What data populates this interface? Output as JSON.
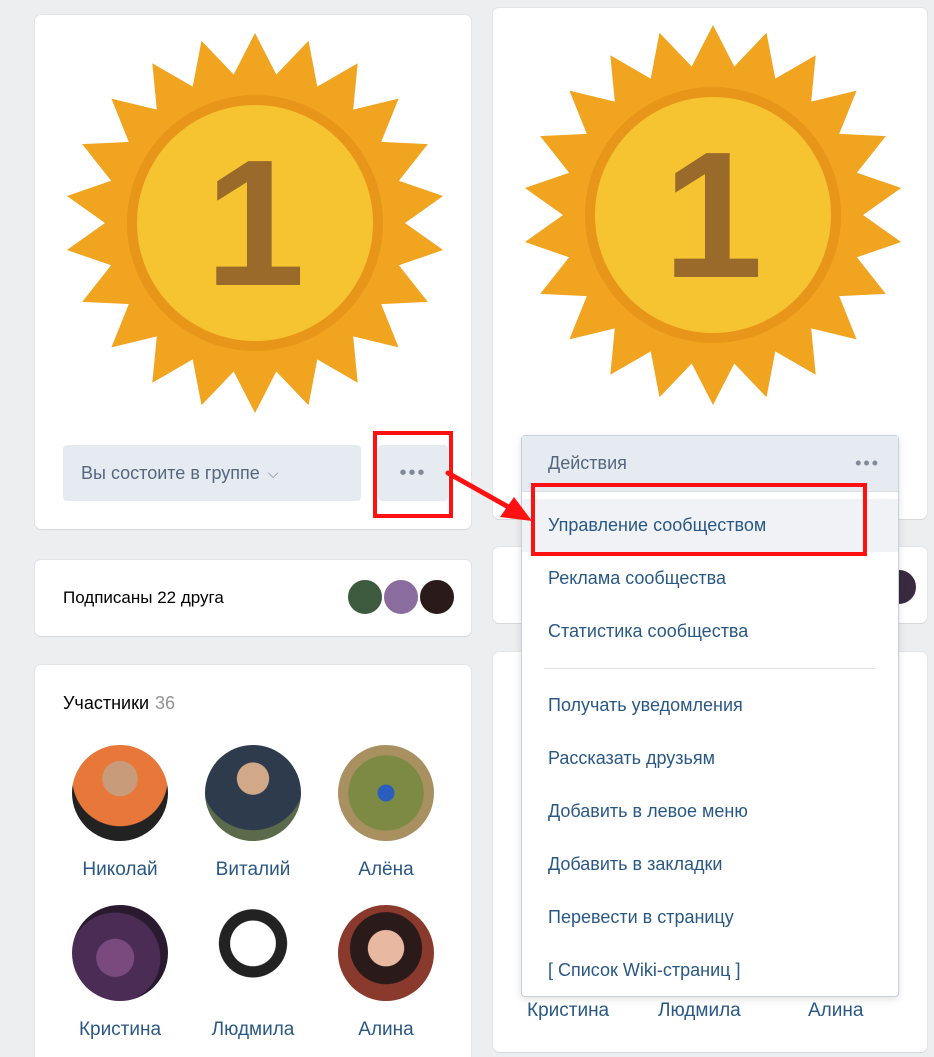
{
  "left_group": {
    "joined_button_label": "Вы состоите в группе",
    "chevron": "⌵",
    "more_dots": "•••",
    "friends_subscribed": "Подписаны 22 друга",
    "members_title": "Участники",
    "members_count": "36",
    "members": [
      {
        "name": "Николай",
        "color": "#e8773a"
      },
      {
        "name": "Виталий",
        "color": "#3a4a5c"
      },
      {
        "name": "Алёна",
        "color": "#7d8a44"
      },
      {
        "name": "Кристина",
        "color": "#4a2c55"
      },
      {
        "name": "Людмила",
        "color": "#222222"
      },
      {
        "name": "Алина",
        "color": "#8a3a2c"
      }
    ]
  },
  "right_group": {
    "actions_label": "Действия",
    "more_dots": "•••",
    "menu_items_top": [
      "Управление сообществом",
      "Реклама сообщества",
      "Статистика сообщества"
    ],
    "menu_items_bottom": [
      "Получать уведомления",
      "Рассказать друзьям",
      "Добавить в левое меню",
      "Добавить в закладки",
      "Перевести в страницу",
      "[ Список Wiki-страниц ]"
    ],
    "under_names": [
      "Кристина",
      "Людмила",
      "Алина"
    ]
  },
  "badge": {
    "number": "1",
    "outer_color": "#f0a41f",
    "inner_color": "#f6c430",
    "number_color": "#9a6a2b"
  },
  "colors": {
    "highlight_red": "#ff1111",
    "link_blue": "#2a5885"
  }
}
